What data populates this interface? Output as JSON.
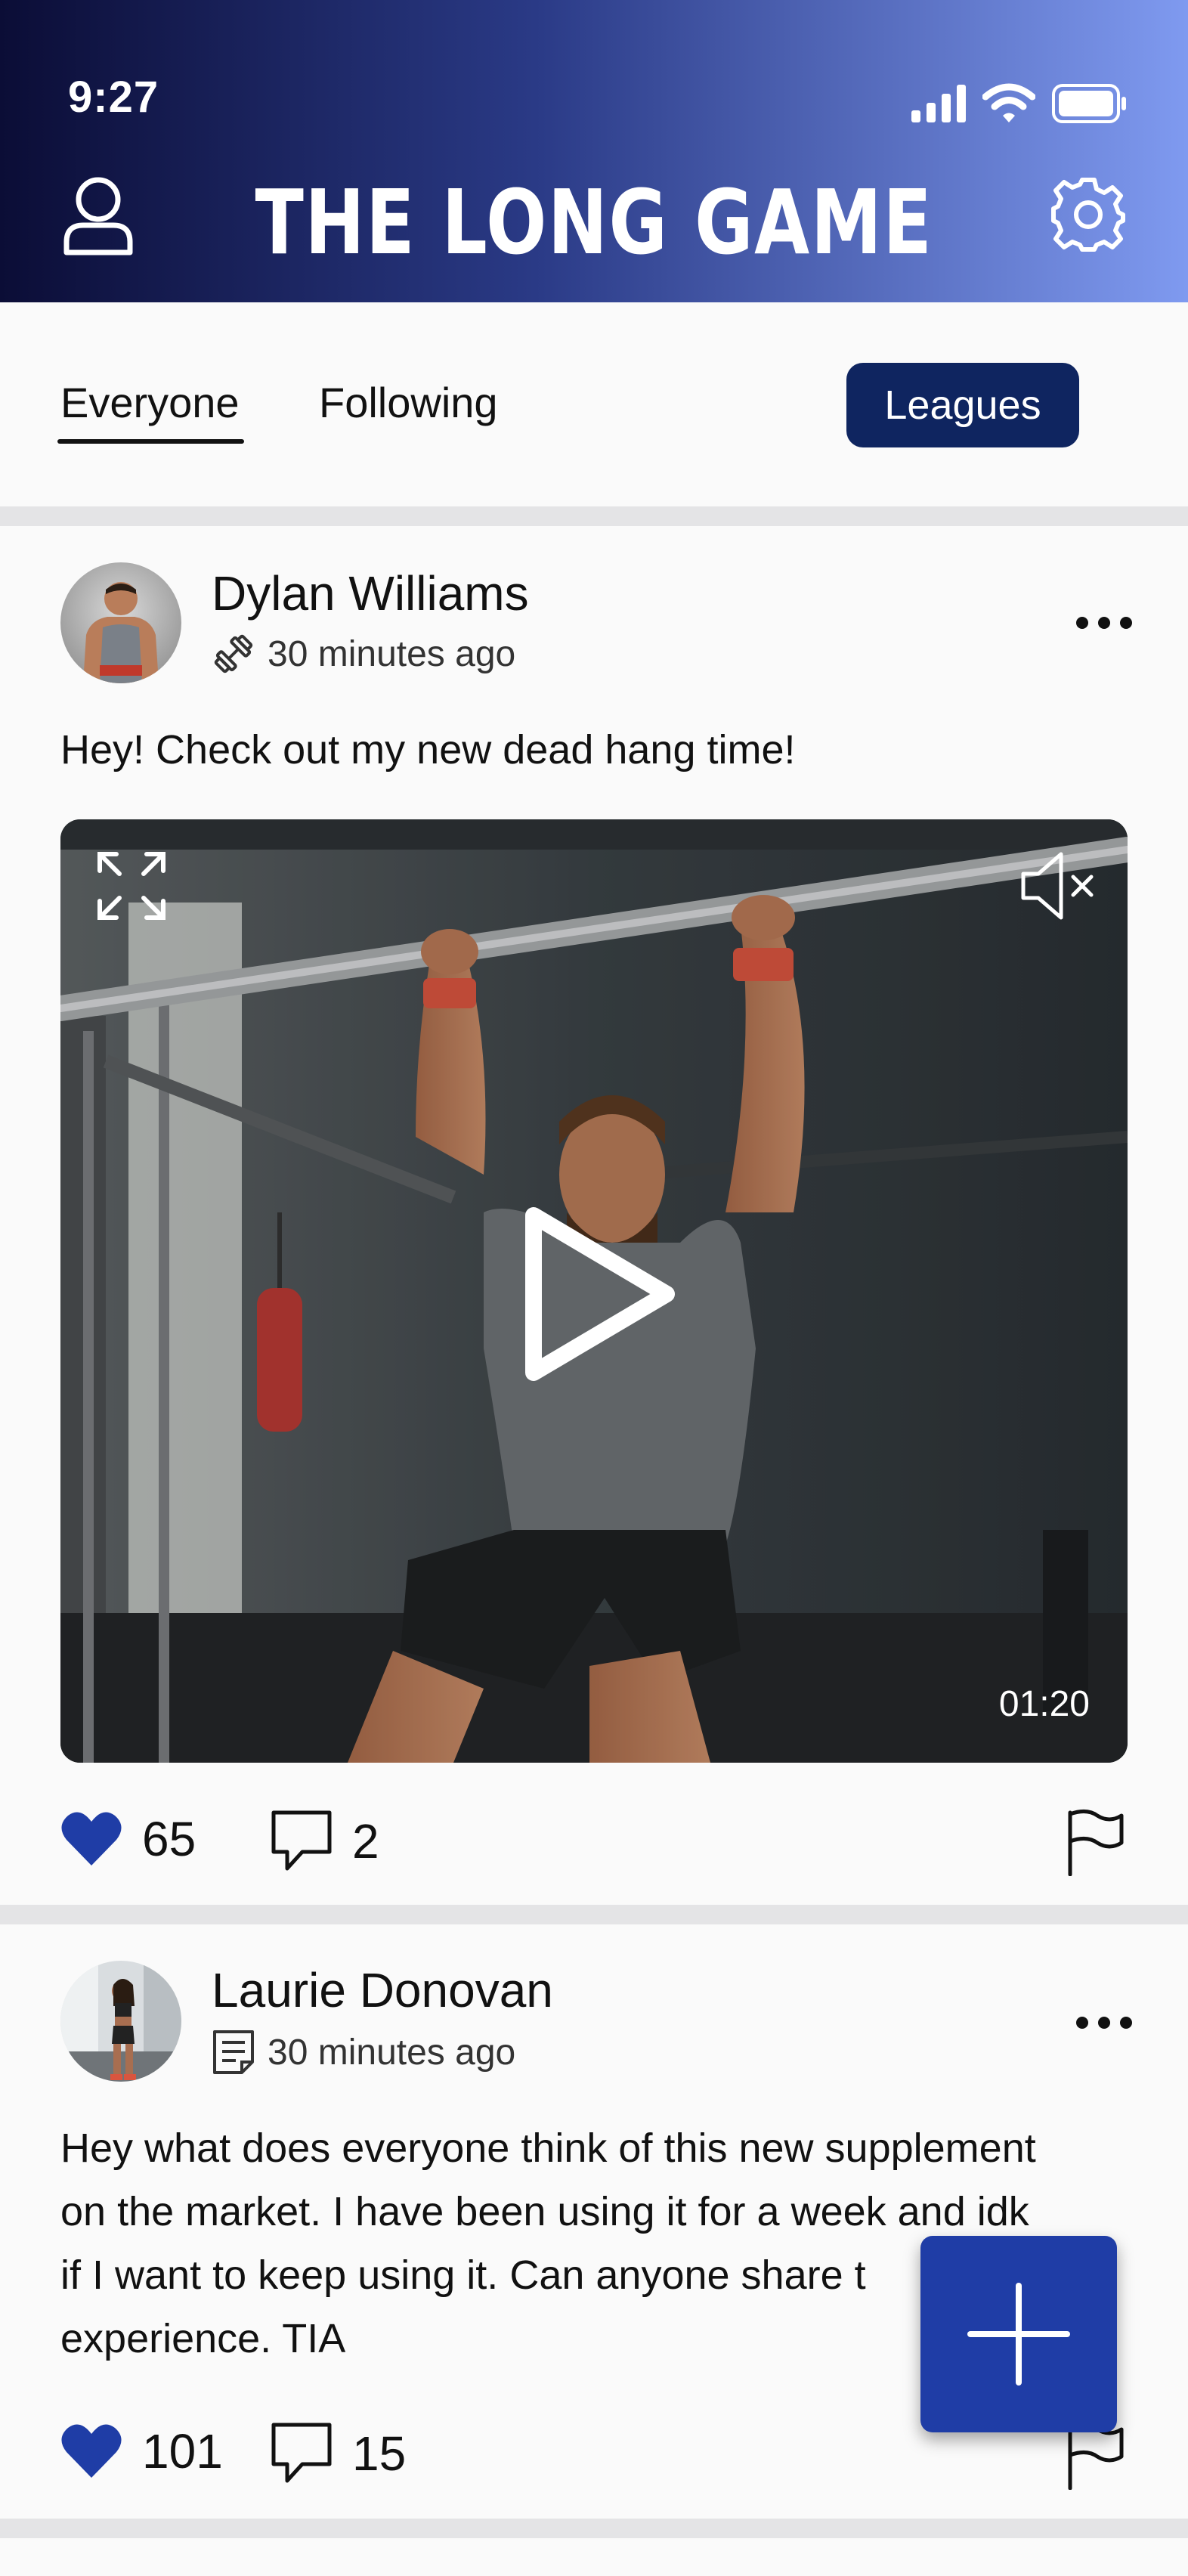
{
  "status_bar": {
    "time": "9:27"
  },
  "header": {
    "title": "THE LONG GAME"
  },
  "tabs": {
    "everyone": "Everyone",
    "following": "Following",
    "leagues": "Leagues"
  },
  "posts": [
    {
      "author": "Dylan Williams",
      "time": "30 minutes ago",
      "type_icon": "dumbbell-icon",
      "text": "Hey! Check out my new dead hang time!",
      "video_duration": "01:20",
      "likes": "65",
      "comments": "2"
    },
    {
      "author": "Laurie Donovan",
      "time": "30 minutes ago",
      "type_icon": "note-icon",
      "text_lines": [
        "Hey what does everyone think of this new supplement",
        "on the market. I have been using it for a week and idk",
        "if I want to keep using it. Can anyone share t",
        "experience. TIA"
      ],
      "likes": "101",
      "comments": "15"
    }
  ],
  "colors": {
    "accent": "#1f3da6",
    "header_dark": "#0b0d36",
    "header_light": "#7f9af0",
    "pill": "#0f2560"
  }
}
